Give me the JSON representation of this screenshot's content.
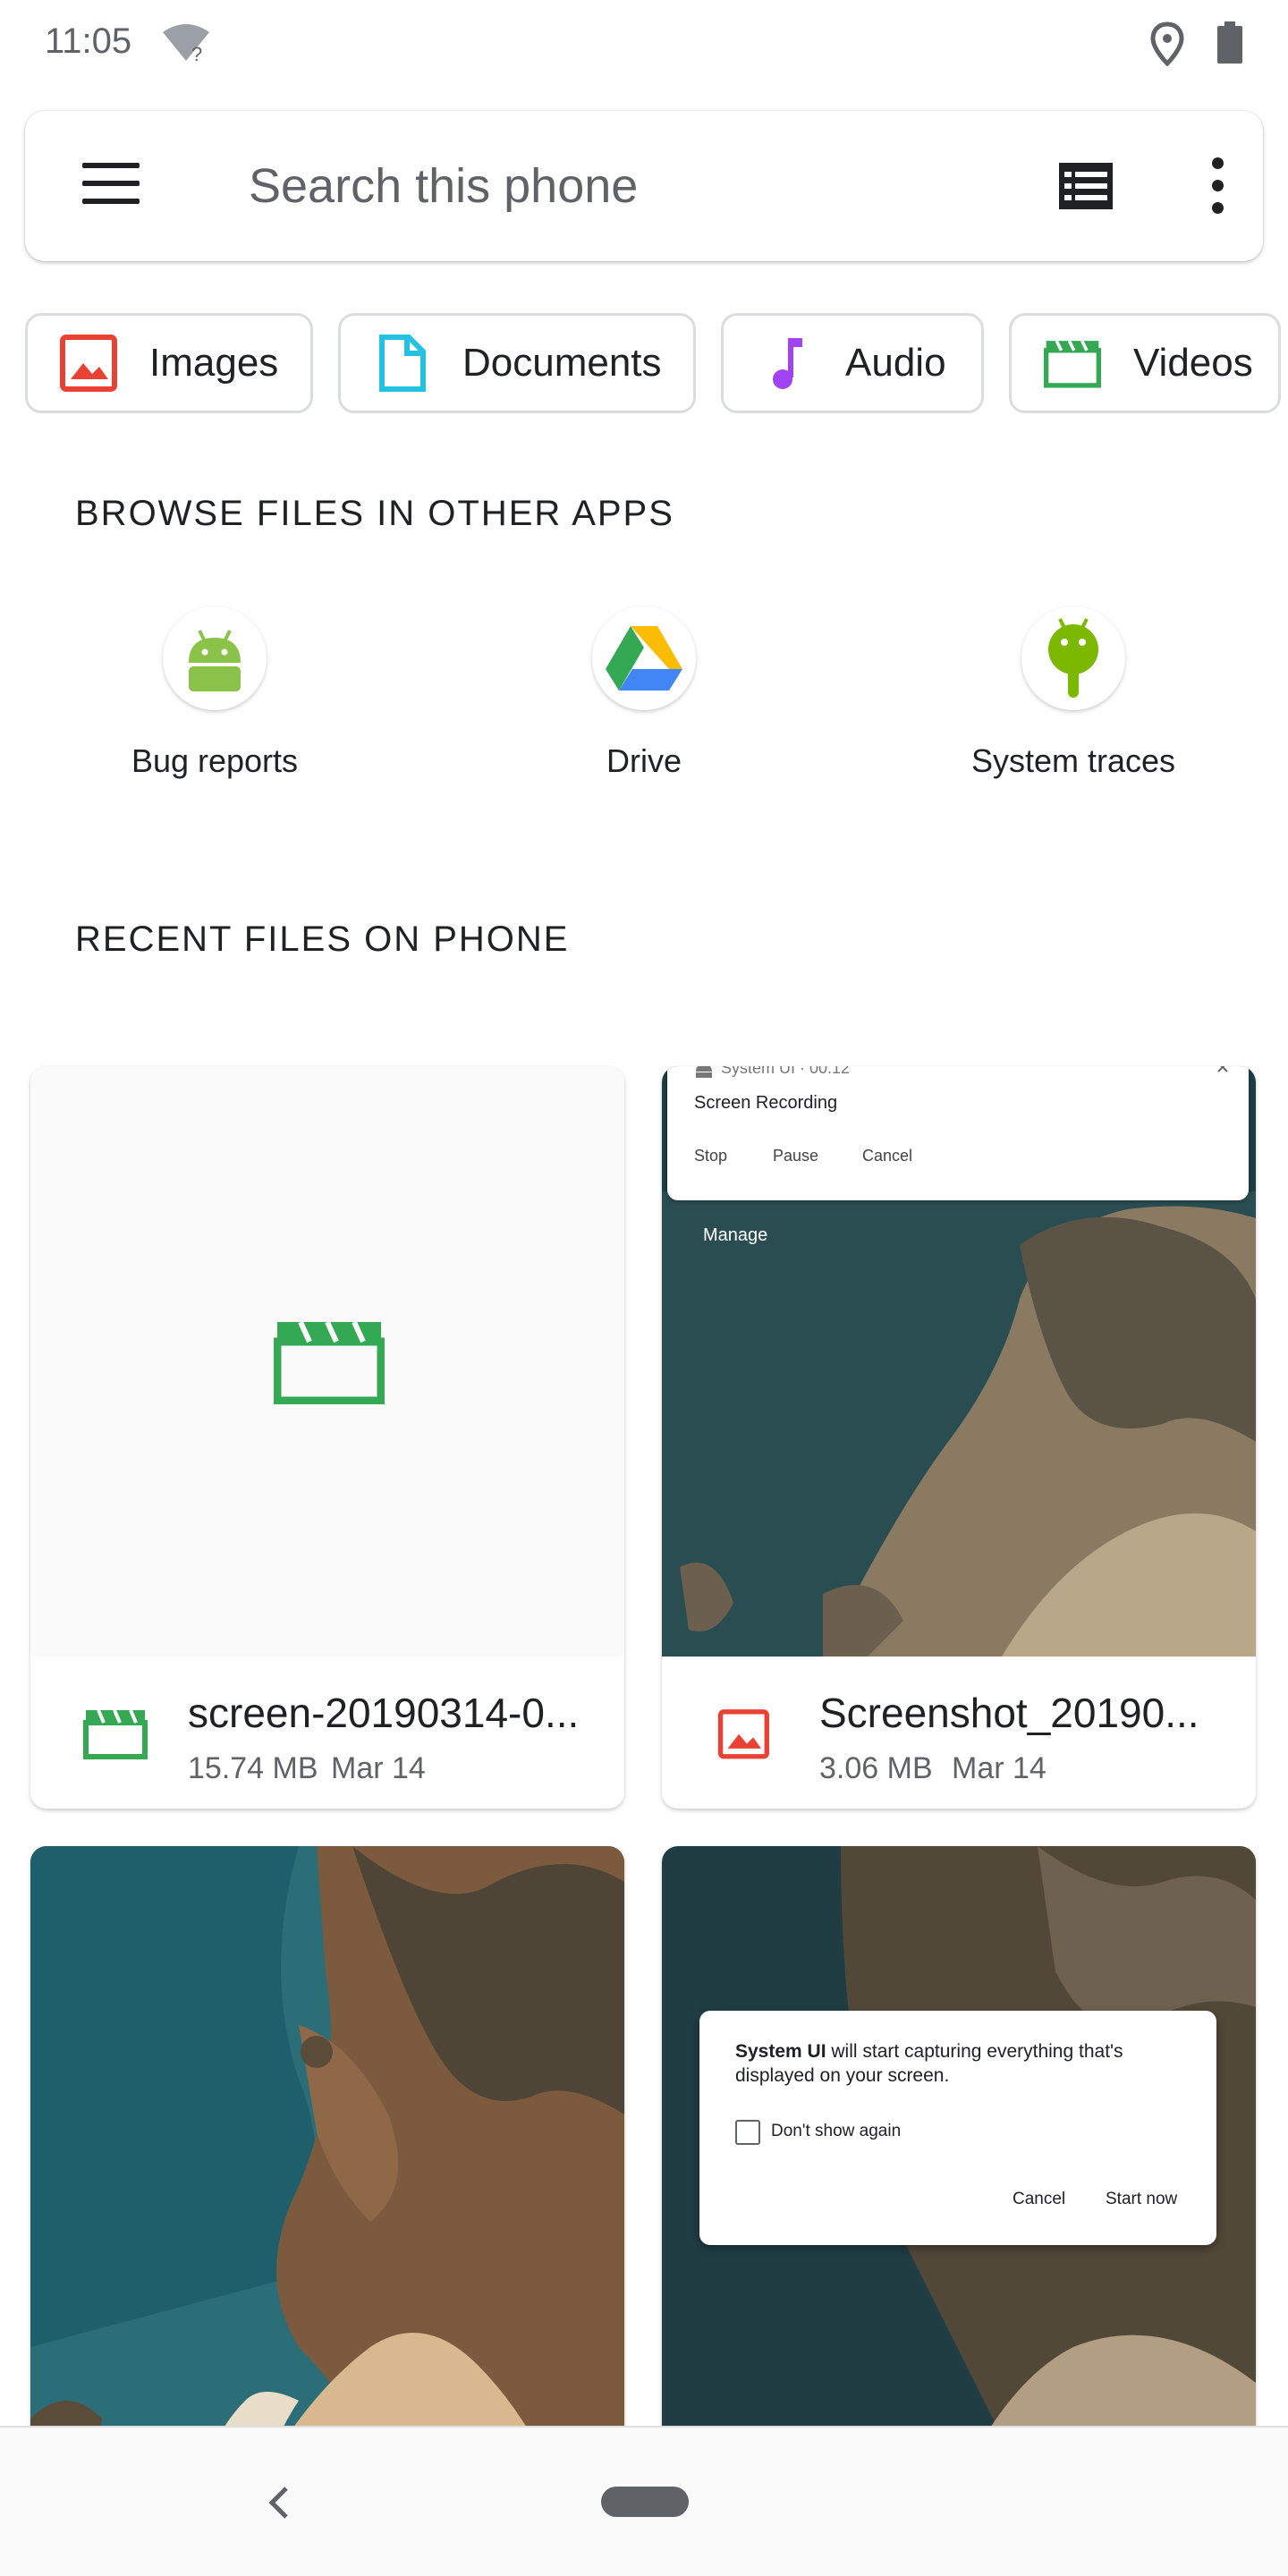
{
  "status_bar": {
    "time": "11:05"
  },
  "search": {
    "placeholder": "Search this phone"
  },
  "categories": [
    {
      "label": "Images",
      "icon": "image-icon",
      "color": "#e94235"
    },
    {
      "label": "Documents",
      "icon": "document-icon",
      "color": "#24c1e0"
    },
    {
      "label": "Audio",
      "icon": "audio-note-icon",
      "color": "#a142f4"
    },
    {
      "label": "Videos",
      "icon": "video-clapper-icon",
      "color": "#34a853"
    }
  ],
  "browse_section": {
    "title": "BROWSE FILES IN OTHER APPS",
    "apps": [
      {
        "label": "Bug reports",
        "icon": "android-icon",
        "color": "#8bc34a"
      },
      {
        "label": "Drive",
        "icon": "google-drive-icon"
      },
      {
        "label": "System traces",
        "icon": "android-traces-icon",
        "color": "#7cb800"
      }
    ]
  },
  "recent_section": {
    "title": "RECENT FILES ON PHONE",
    "files": [
      {
        "name": "screen-20190314-0...",
        "size": "15.74 MB",
        "date": "Mar 14",
        "type_icon": "video-icon"
      },
      {
        "name": "Screenshot_20190...",
        "size": "3.06 MB",
        "date": "Mar 14",
        "type_icon": "image-icon"
      }
    ]
  },
  "preview_recording": {
    "app": "System UI · 00:12",
    "title": "Screen Recording",
    "actions": [
      "Stop",
      "Pause",
      "Cancel"
    ],
    "manage": "Manage"
  },
  "preview_dialog": {
    "app_name": "System UI",
    "message": " will start capturing everything that's displayed on your screen.",
    "checkbox": "Don't show again",
    "cancel": "Cancel",
    "start": "Start now"
  },
  "colors": {
    "accent_video": "#34a853",
    "accent_image": "#e94235",
    "text_secondary": "#5f6368"
  }
}
